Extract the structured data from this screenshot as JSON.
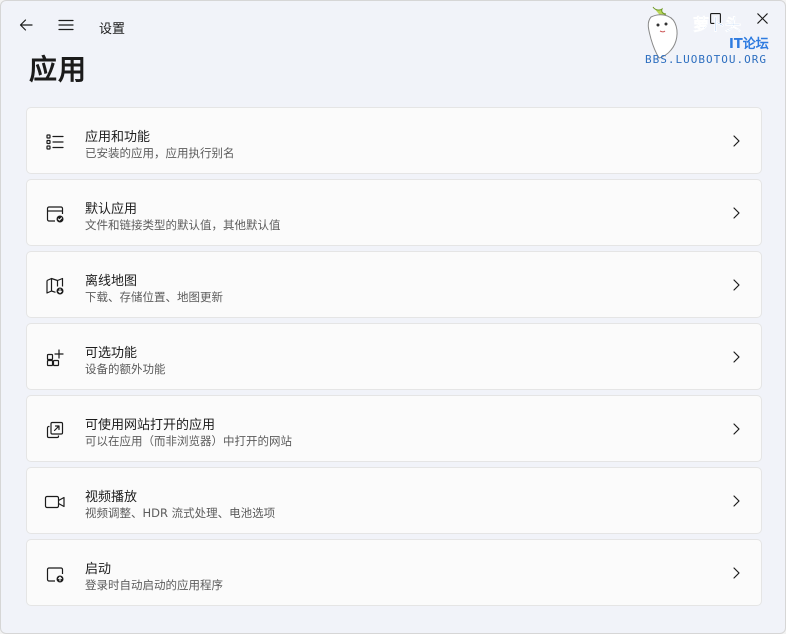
{
  "window": {
    "app_title": "设置",
    "page_title": "应用"
  },
  "titlebar_icons": {
    "back": "back-arrow-icon",
    "menu": "hamburger-menu-icon",
    "maximize": "maximize-icon",
    "close": "close-icon"
  },
  "items": [
    {
      "title": "应用和功能",
      "subtitle": "已安装的应用，应用执行别名",
      "icon": "apps-list-icon"
    },
    {
      "title": "默认应用",
      "subtitle": "文件和链接类型的默认值，其他默认值",
      "icon": "default-apps-icon"
    },
    {
      "title": "离线地图",
      "subtitle": "下载、存储位置、地图更新",
      "icon": "offline-map-icon"
    },
    {
      "title": "可选功能",
      "subtitle": "设备的额外功能",
      "icon": "optional-features-icon"
    },
    {
      "title": "可使用网站打开的应用",
      "subtitle": "可以在应用（而非浏览器）中打开的网站",
      "icon": "apps-for-websites-icon"
    },
    {
      "title": "视频播放",
      "subtitle": "视频调整、HDR 流式处理、电池选项",
      "icon": "video-camera-icon"
    },
    {
      "title": "启动",
      "subtitle": "登录时自动启动的应用程序",
      "icon": "startup-icon"
    }
  ],
  "watermark": {
    "line1": "萝卜头",
    "line2": "IT论坛",
    "line3": "BBS.LUOBOTOU.ORG"
  }
}
